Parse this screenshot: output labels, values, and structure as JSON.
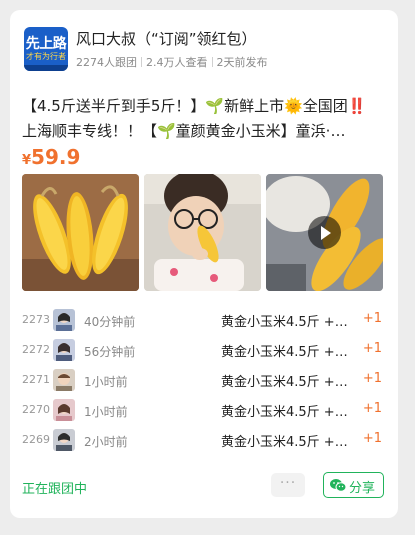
{
  "header": {
    "avatar_text_top": "先上路",
    "avatar_text_bottom": "才有为行者",
    "title": "风口大叔（“订阅”领红包）",
    "followers": "2274人跟团",
    "views": "2.4万人查看",
    "posted": "2天前发布"
  },
  "post": {
    "description_line1": "【4.5斤送半斤到手5斤！】🌱新鲜上市🌞全国团‼️",
    "description_line2": "上海顺丰专线！！【🌱童颜黄金小玉米】童浜·…",
    "price_currency": "¥",
    "price_value": "59.9"
  },
  "media": {
    "image1_tag": "",
    "has_video": true,
    "icons": [
      "play-icon"
    ]
  },
  "orders": [
    {
      "no": "2273",
      "time": "40分钟前",
      "product": "黄金小玉米4.5斤 +…",
      "qty": "+1"
    },
    {
      "no": "2272",
      "time": "56分钟前",
      "product": "黄金小玉米4.5斤 +…",
      "qty": "+1"
    },
    {
      "no": "2271",
      "time": "1小时前",
      "product": "黄金小玉米4.5斤 +…",
      "qty": "+1"
    },
    {
      "no": "2270",
      "time": "1小时前",
      "product": "黄金小玉米4.5斤 +…",
      "qty": "+1"
    },
    {
      "no": "2269",
      "time": "2小时前",
      "product": "黄金小玉米4.5斤 +…",
      "qty": "+1"
    }
  ],
  "footer": {
    "status": "正在跟团中",
    "more": "···",
    "share": "分享"
  },
  "colors": {
    "accent_orange": "#f0712e",
    "wechat_green": "#21b35b",
    "avatar_blue": "#1a5fc8"
  }
}
